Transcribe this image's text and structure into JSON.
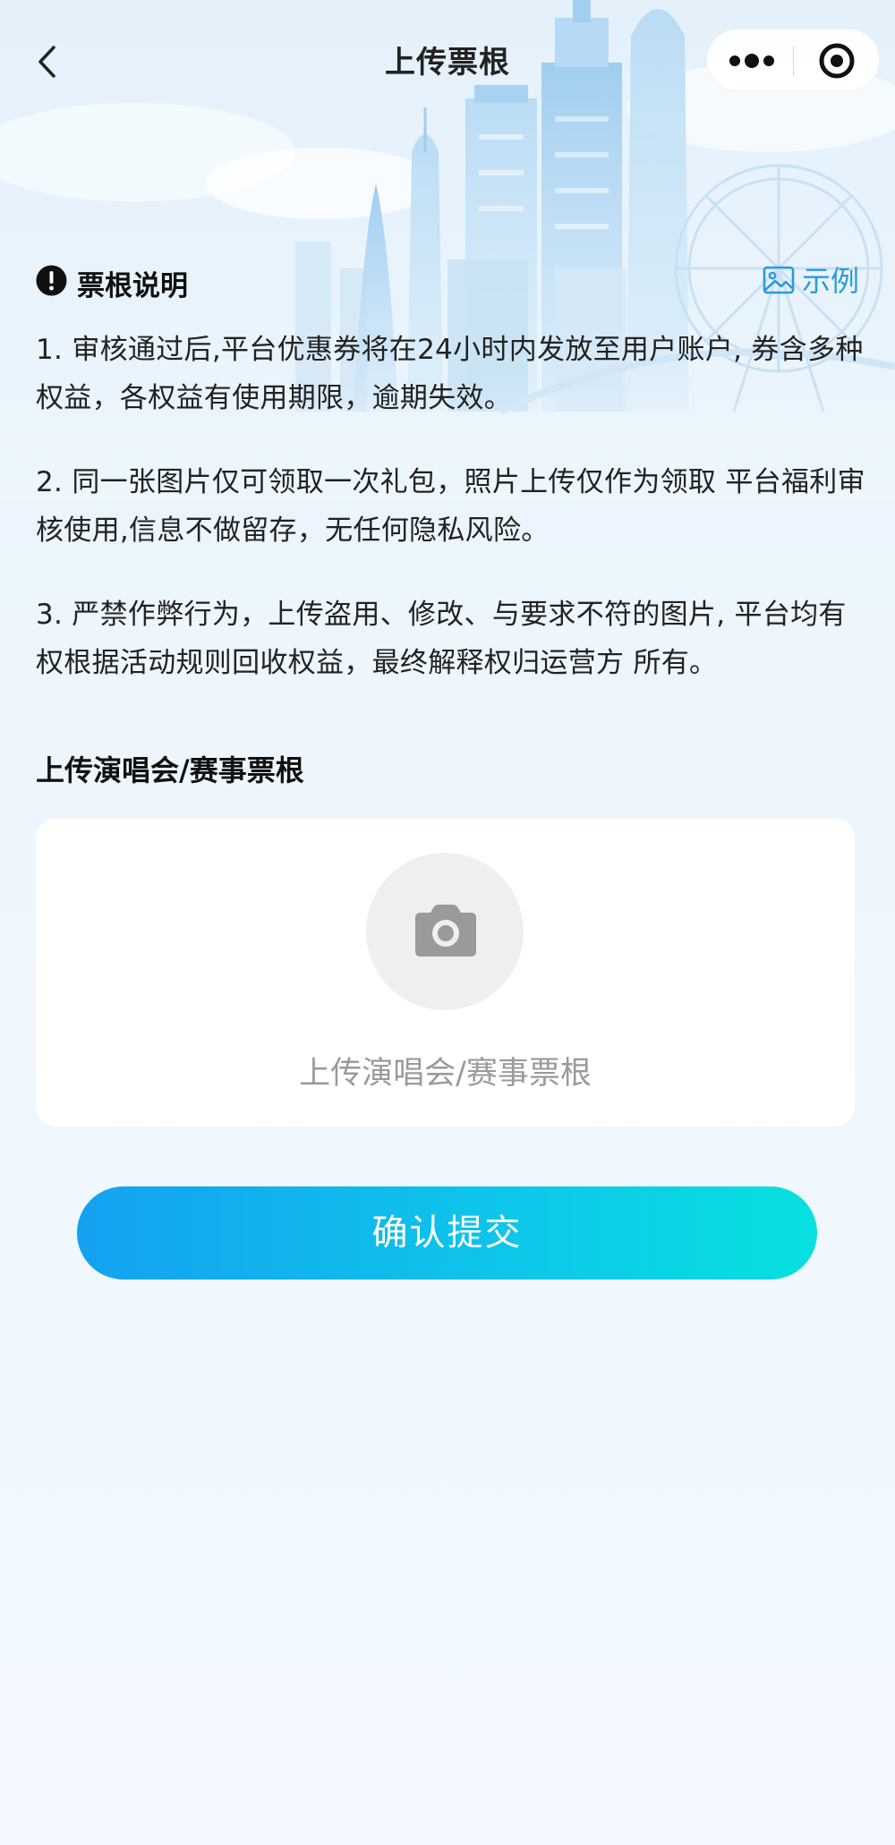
{
  "nav": {
    "title": "上传票根",
    "back_icon": "chevron-left-icon",
    "more_icon": "more-dots-icon",
    "close_icon": "target-close-icon"
  },
  "notes": {
    "title": "票根说明",
    "warning_icon": "exclamation-circle-icon",
    "example_label": "示例",
    "example_icon": "image-icon",
    "items": [
      "1. 审核通过后,平台优惠券将在24小时内发放至用户账户, 券含多种权益，各权益有使用期限，逾期失效。",
      "2. 同一张图片仅可领取一次礼包，照片上传仅作为领取 平台福利审核使用,信息不做留存，无任何隐私风险。",
      "3. 严禁作弊行为，上传盗用、修改、与要求不符的图片, 平台均有权根据活动规则回收权益，最终解释权归运营方 所有。"
    ]
  },
  "upload": {
    "heading": "上传演唱会/赛事票根",
    "placeholder_label": "上传演唱会/赛事票根",
    "camera_icon": "camera-icon"
  },
  "submit": {
    "label": "确认提交"
  },
  "colors": {
    "accent": "#2c9ad8",
    "button_start": "#14a1f0",
    "button_end": "#07e0e0",
    "background": "#eef6fd"
  }
}
